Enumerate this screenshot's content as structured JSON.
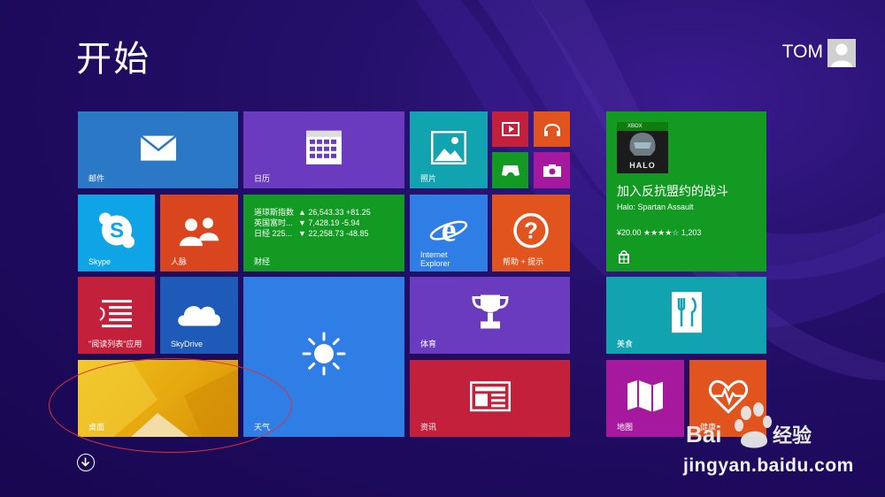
{
  "header": {
    "title": "开始",
    "user": "TOM"
  },
  "tiles": {
    "mail": {
      "label": "邮件",
      "color": "#2b78c6"
    },
    "calendar": {
      "label": "日历",
      "color": "#6b3bbf"
    },
    "photos": {
      "label": "照片",
      "color": "#11a3b0"
    },
    "video": {
      "color": "#c3213b"
    },
    "music": {
      "color": "#e2541e"
    },
    "games": {
      "color": "#129a22"
    },
    "camera": {
      "color": "#a6189d"
    },
    "skype": {
      "label": "Skype",
      "color": "#0ea4e6"
    },
    "people": {
      "label": "人脉",
      "color": "#d9451f"
    },
    "finance": {
      "label": "财经",
      "color": "#129a22",
      "rows": [
        {
          "name": "道琼斯指数",
          "value": "▲ 26,543.33 +81.25"
        },
        {
          "name": "英国富时...",
          "value": "▼ 7,428.19 -5.94"
        },
        {
          "name": "日经 225...",
          "value": "▼ 22,258.73 -48.85"
        }
      ]
    },
    "ie": {
      "label_line1": "Internet",
      "label_line2": "Explorer",
      "color": "#2f7ee6"
    },
    "help": {
      "label": "帮助 + 提示",
      "color": "#e2541e"
    },
    "reading": {
      "label": "\"阅读列表\"应用",
      "color": "#c3213b"
    },
    "skydrive": {
      "label": "SkyDrive",
      "color": "#1e5ab8"
    },
    "weather": {
      "label": "天气",
      "color": "#2f7ee6"
    },
    "sports": {
      "label": "体育",
      "color": "#6b3bbf"
    },
    "desktop": {
      "label": "桌面",
      "color": "#e8b010"
    },
    "news": {
      "label": "资讯",
      "color": "#c3213b"
    },
    "store": {
      "color": "#129a22",
      "xbox": "XBOX",
      "title": "加入反抗盟约的战斗",
      "subtitle": "Halo: Spartan Assault",
      "price_line": "¥20.00 ★★★★☆ 1,203"
    },
    "food": {
      "label": "美食",
      "color": "#11a3b0"
    },
    "maps": {
      "label": "地图",
      "color": "#a6189d"
    },
    "health": {
      "label": "健康",
      "color": "#e2541e"
    }
  },
  "watermark": {
    "brand": "Bai 经验",
    "url": "jingyan.baidu.com"
  }
}
